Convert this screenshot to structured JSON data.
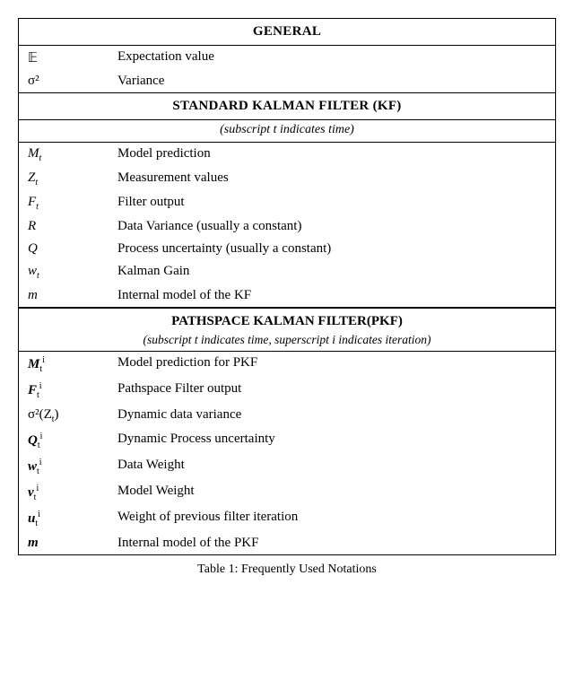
{
  "caption": "Table 1: Frequently Used Notations",
  "sections": {
    "general": {
      "header": "GENERAL",
      "entries": [
        {
          "symbol_html": "𝔼",
          "description": "Expectation value"
        },
        {
          "symbol_html": "σ²",
          "description": "Variance"
        }
      ]
    },
    "kf": {
      "header": "STANDARD KALMAN FILTER (KF)",
      "subheader": "(subscript t indicates time)",
      "entries": [
        {
          "symbol_html": "M<sub>t</sub>",
          "description": "Model prediction"
        },
        {
          "symbol_html": "Z<sub>t</sub>",
          "description": "Measurement values"
        },
        {
          "symbol_html": "F<sub>t</sub>",
          "description": "Filter output"
        },
        {
          "symbol_html": "R",
          "description": "Data Variance (usually a constant)"
        },
        {
          "symbol_html": "Q",
          "description": "Process uncertainty (usually a constant)"
        },
        {
          "symbol_html": "w<sub>t</sub>",
          "description": "Kalman Gain"
        },
        {
          "symbol_html": "m",
          "description": "Internal model of the KF"
        }
      ]
    },
    "pkf": {
      "header": "PATHSPACE KALMAN FILTER(PKF)",
      "subheader": "(subscript t indicates time, superscript i indicates iteration)",
      "entries": [
        {
          "symbol_html": "<b><i>M</i></b><sub>t</sub><sup>i</sup>",
          "description": "Model prediction for PKF"
        },
        {
          "symbol_html": "<b><i>F</i></b><sub>t</sub><sup>i</sup>",
          "description": "Pathspace Filter output"
        },
        {
          "symbol_html": "σ²(Z<sub>t</sub>)",
          "description": "Dynamic data variance"
        },
        {
          "symbol_html": "<b><i>Q</i></b><sub>t</sub><sup>i</sup>",
          "description": "Dynamic Process uncertainty"
        },
        {
          "symbol_html": "<b><i>w</i></b><sub>t</sub><sup>i</sup>",
          "description": "Data Weight"
        },
        {
          "symbol_html": "<b><i>v</i></b><sub>t</sub><sup>i</sup>",
          "description": "Model Weight"
        },
        {
          "symbol_html": "<b><i>u</i></b><sub>t</sub><sup>i</sup>",
          "description": "Weight of previous filter iteration"
        },
        {
          "symbol_html": "<b><i>m</i></b>",
          "description": "Internal model of the PKF"
        }
      ]
    }
  }
}
